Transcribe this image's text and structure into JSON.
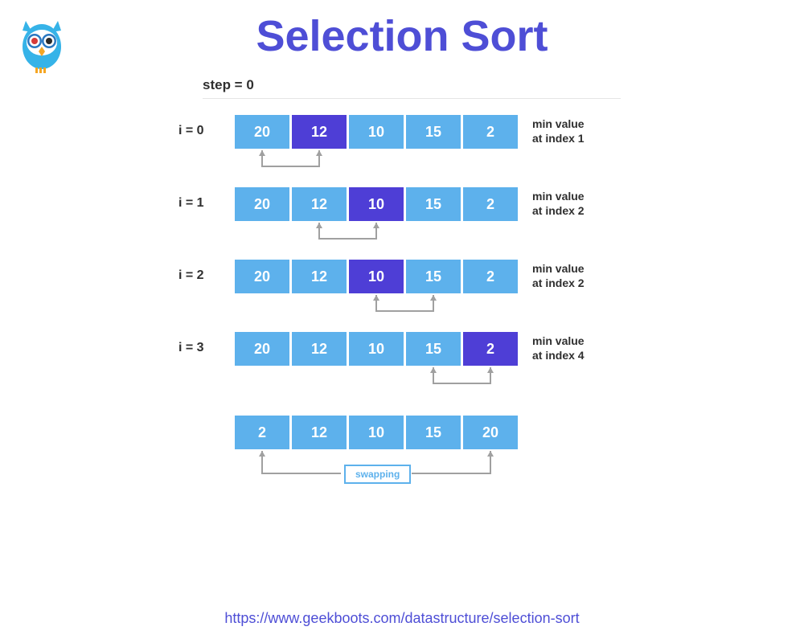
{
  "title": "Selection Sort",
  "subtitle": "step = 0",
  "colors": {
    "cell_normal": "#5db1ec",
    "cell_highlight": "#4e3ed6",
    "title": "#4e4ed6",
    "arrow": "#a0a0a0"
  },
  "rows": [
    {
      "label": "i = 0",
      "values": [
        "20",
        "12",
        "10",
        "15",
        "2"
      ],
      "highlight_index": 1,
      "note_line1": "min value",
      "note_line2": "at index 1",
      "arrow_from": 0,
      "arrow_to": 1
    },
    {
      "label": "i = 1",
      "values": [
        "20",
        "12",
        "10",
        "15",
        "2"
      ],
      "highlight_index": 2,
      "note_line1": "min value",
      "note_line2": "at index 2",
      "arrow_from": 1,
      "arrow_to": 2
    },
    {
      "label": "i = 2",
      "values": [
        "20",
        "12",
        "10",
        "15",
        "2"
      ],
      "highlight_index": 2,
      "note_line1": "min value",
      "note_line2": "at index 2",
      "arrow_from": 2,
      "arrow_to": 3
    },
    {
      "label": "i = 3",
      "values": [
        "20",
        "12",
        "10",
        "15",
        "2"
      ],
      "highlight_index": 4,
      "note_line1": "min value",
      "note_line2": "at index 4",
      "arrow_from": 3,
      "arrow_to": 4
    }
  ],
  "final_row": {
    "values": [
      "2",
      "12",
      "10",
      "15",
      "20"
    ],
    "swap_label": "swapping",
    "arrow_from": 0,
    "arrow_to": 4
  },
  "footer_url": "https://www.geekboots.com/datastructure/selection-sort"
}
